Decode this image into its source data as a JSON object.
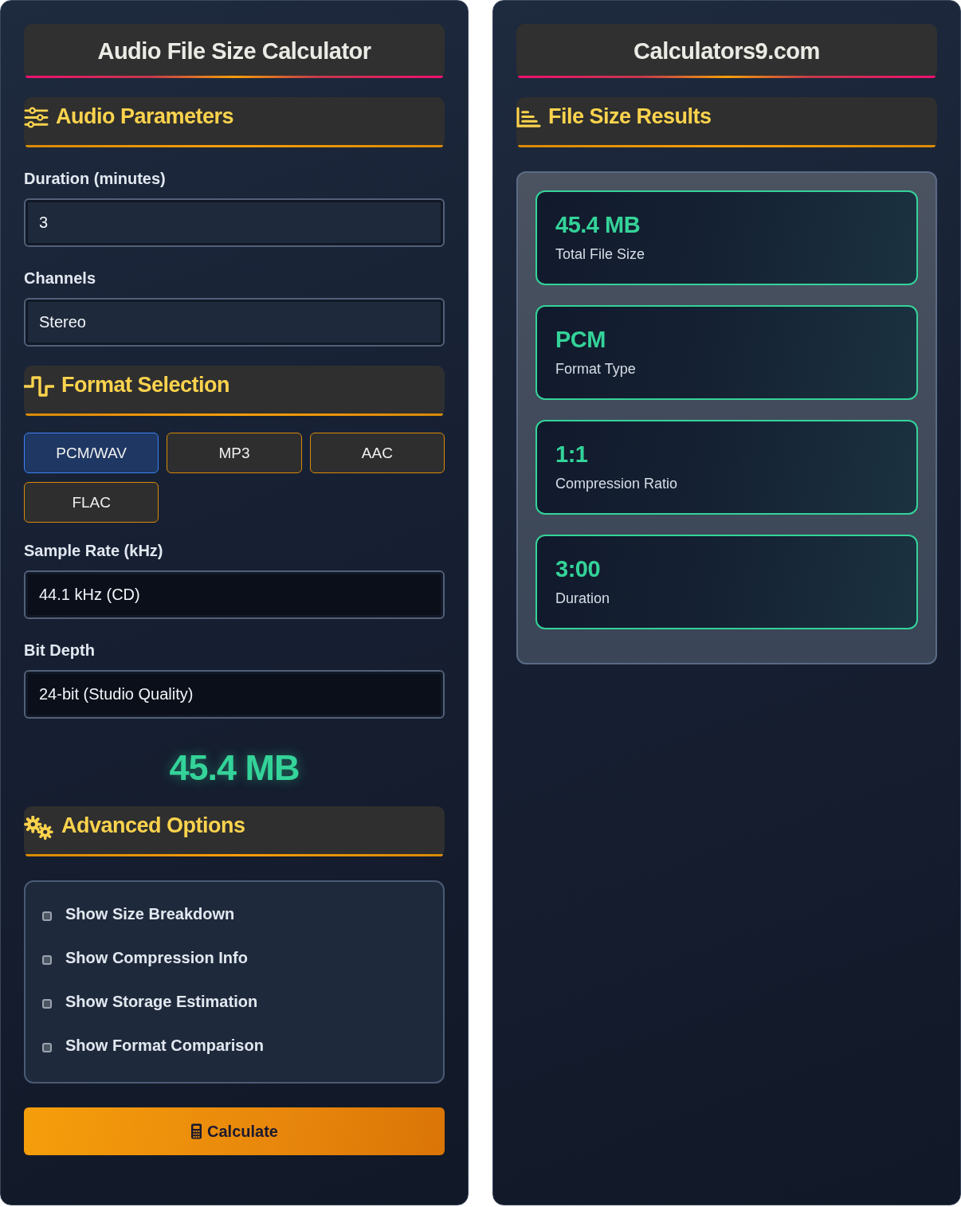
{
  "left_panel": {
    "title": "Audio File Size Calculator",
    "parameters_heading": "Audio Parameters",
    "parameter_fields": [
      {
        "label": "Duration (minutes)",
        "kind": "input",
        "value": "3"
      },
      {
        "label": "Channels",
        "kind": "input",
        "value": "Stereo"
      }
    ],
    "format_heading": "Format Selection",
    "formats": [
      {
        "label": "PCM/WAV",
        "selected": true
      },
      {
        "label": "MP3",
        "selected": false
      },
      {
        "label": "AAC",
        "selected": false
      },
      {
        "label": "FLAC",
        "selected": false
      }
    ],
    "quality_fields": [
      {
        "label": "Sample Rate (kHz)",
        "kind": "select",
        "value": "44.1 kHz (CD)"
      },
      {
        "label": "Bit Depth",
        "kind": "select",
        "value": "24-bit (Studio Quality)"
      }
    ],
    "result": "45.4 MB",
    "advanced_heading": "Advanced Options",
    "options": [
      {
        "label": "Show Size Breakdown",
        "checked": false
      },
      {
        "label": "Show Compression Info",
        "checked": false
      },
      {
        "label": "Show Storage Estimation",
        "checked": false
      },
      {
        "label": "Show Format Comparison",
        "checked": false
      }
    ],
    "calculate_button": "Calculate"
  },
  "right_panel": {
    "title": "Calculators9.com",
    "results_heading": "File Size Results",
    "results": [
      {
        "value": "45.4 MB",
        "label": "Total File Size"
      },
      {
        "value": "PCM",
        "label": "Format Type"
      },
      {
        "value": "1:1",
        "label": "Compression Ratio"
      },
      {
        "value": "3:00",
        "label": "Duration"
      }
    ]
  }
}
